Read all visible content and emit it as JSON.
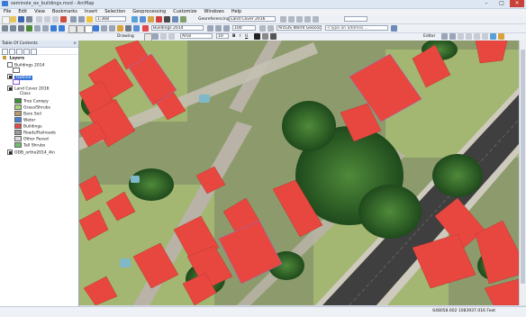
{
  "window": {
    "title": "seminole_ex_buildings.mxd - ArcMap"
  },
  "menu": [
    "File",
    "Edit",
    "View",
    "Bookmarks",
    "Insert",
    "Selection",
    "Geoprocessing",
    "Customize",
    "Windows",
    "Help"
  ],
  "toolbar": {
    "scale": "1:368",
    "georef_label": "Georeferencing",
    "georef_layer": "Land Cover 2016",
    "target_layer": "Buildings 2014",
    "zoom_percent": "100",
    "geocoding": "ArcGIS World Geocoding",
    "address_placeholder": "<Type an address ...",
    "drawing_label": "Drawing",
    "font_name": "Arial",
    "font_size": "10",
    "editor_label": "Editor"
  },
  "toc": {
    "title": "Table Of Contents",
    "close": "×",
    "layers_label": "Layers",
    "items": [
      {
        "label": "Buildings 2014",
        "checked": false
      },
      {
        "label": "Outline",
        "checked": true,
        "selected": true
      },
      {
        "label": "Land Cover 2016",
        "checked": true
      },
      {
        "label": "Class"
      },
      {
        "label": "Tree Canopy",
        "color": "#3f8f3a"
      },
      {
        "label": "Grass/Shrubs",
        "color": "#a6d97c"
      },
      {
        "label": "Bare Soil",
        "color": "#b79a6b"
      },
      {
        "label": "Water",
        "color": "#3f7fd9"
      },
      {
        "label": "Buildings",
        "color": "#e04a4a"
      },
      {
        "label": "Roads/Railroads",
        "color": "#9a9a9a"
      },
      {
        "label": "Other Paved",
        "color": "#dcdcdc"
      },
      {
        "label": "Tall Shrubs",
        "color": "#6fbf6a"
      },
      {
        "label": "ODB_ortho2014_4in",
        "checked": true
      }
    ]
  },
  "status": {
    "coordinates": "648058.602  1083937.016 Feet"
  },
  "colors": {
    "building": "#e8473f",
    "road": "#4a4a4a",
    "tree": "#2f6a2a",
    "grass": "#8ca35f"
  }
}
